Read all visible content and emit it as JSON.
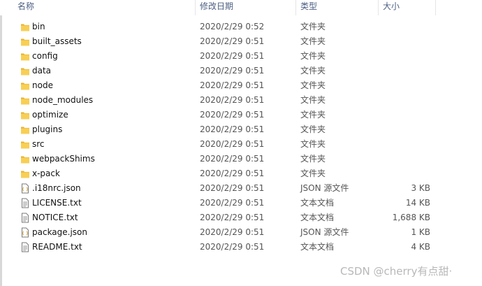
{
  "columns": {
    "name": "名称",
    "modified": "修改日期",
    "type": "类型",
    "size": "大小"
  },
  "files": [
    {
      "name": "bin",
      "modified": "2020/2/29 0:52",
      "type": "文件夹",
      "size": "",
      "icon": "folder-icon"
    },
    {
      "name": "built_assets",
      "modified": "2020/2/29 0:51",
      "type": "文件夹",
      "size": "",
      "icon": "folder-icon"
    },
    {
      "name": "config",
      "modified": "2020/2/29 0:51",
      "type": "文件夹",
      "size": "",
      "icon": "folder-icon"
    },
    {
      "name": "data",
      "modified": "2020/2/29 0:51",
      "type": "文件夹",
      "size": "",
      "icon": "folder-icon"
    },
    {
      "name": "node",
      "modified": "2020/2/29 0:51",
      "type": "文件夹",
      "size": "",
      "icon": "folder-icon"
    },
    {
      "name": "node_modules",
      "modified": "2020/2/29 0:51",
      "type": "文件夹",
      "size": "",
      "icon": "folder-icon"
    },
    {
      "name": "optimize",
      "modified": "2020/2/29 0:51",
      "type": "文件夹",
      "size": "",
      "icon": "folder-icon"
    },
    {
      "name": "plugins",
      "modified": "2020/2/29 0:51",
      "type": "文件夹",
      "size": "",
      "icon": "folder-icon"
    },
    {
      "name": "src",
      "modified": "2020/2/29 0:51",
      "type": "文件夹",
      "size": "",
      "icon": "folder-icon"
    },
    {
      "name": "webpackShims",
      "modified": "2020/2/29 0:51",
      "type": "文件夹",
      "size": "",
      "icon": "folder-icon"
    },
    {
      "name": "x-pack",
      "modified": "2020/2/29 0:51",
      "type": "文件夹",
      "size": "",
      "icon": "folder-icon"
    },
    {
      "name": ".i18nrc.json",
      "modified": "2020/2/29 0:51",
      "type": "JSON 源文件",
      "size": "3 KB",
      "icon": "json-file-icon"
    },
    {
      "name": "LICENSE.txt",
      "modified": "2020/2/29 0:51",
      "type": "文本文档",
      "size": "14 KB",
      "icon": "text-file-icon"
    },
    {
      "name": "NOTICE.txt",
      "modified": "2020/2/29 0:51",
      "type": "文本文档",
      "size": "1,688 KB",
      "icon": "text-file-icon"
    },
    {
      "name": "package.json",
      "modified": "2020/2/29 0:51",
      "type": "JSON 源文件",
      "size": "1 KB",
      "icon": "json-file-icon"
    },
    {
      "name": "README.txt",
      "modified": "2020/2/29 0:51",
      "type": "文本文档",
      "size": "4 KB",
      "icon": "text-file-icon"
    }
  ],
  "watermark": "CSDN @cherry有点甜·",
  "colors": {
    "folder": "#f5c23d",
    "header_text": "#4d6082",
    "file_outline": "#7a7a7a"
  }
}
